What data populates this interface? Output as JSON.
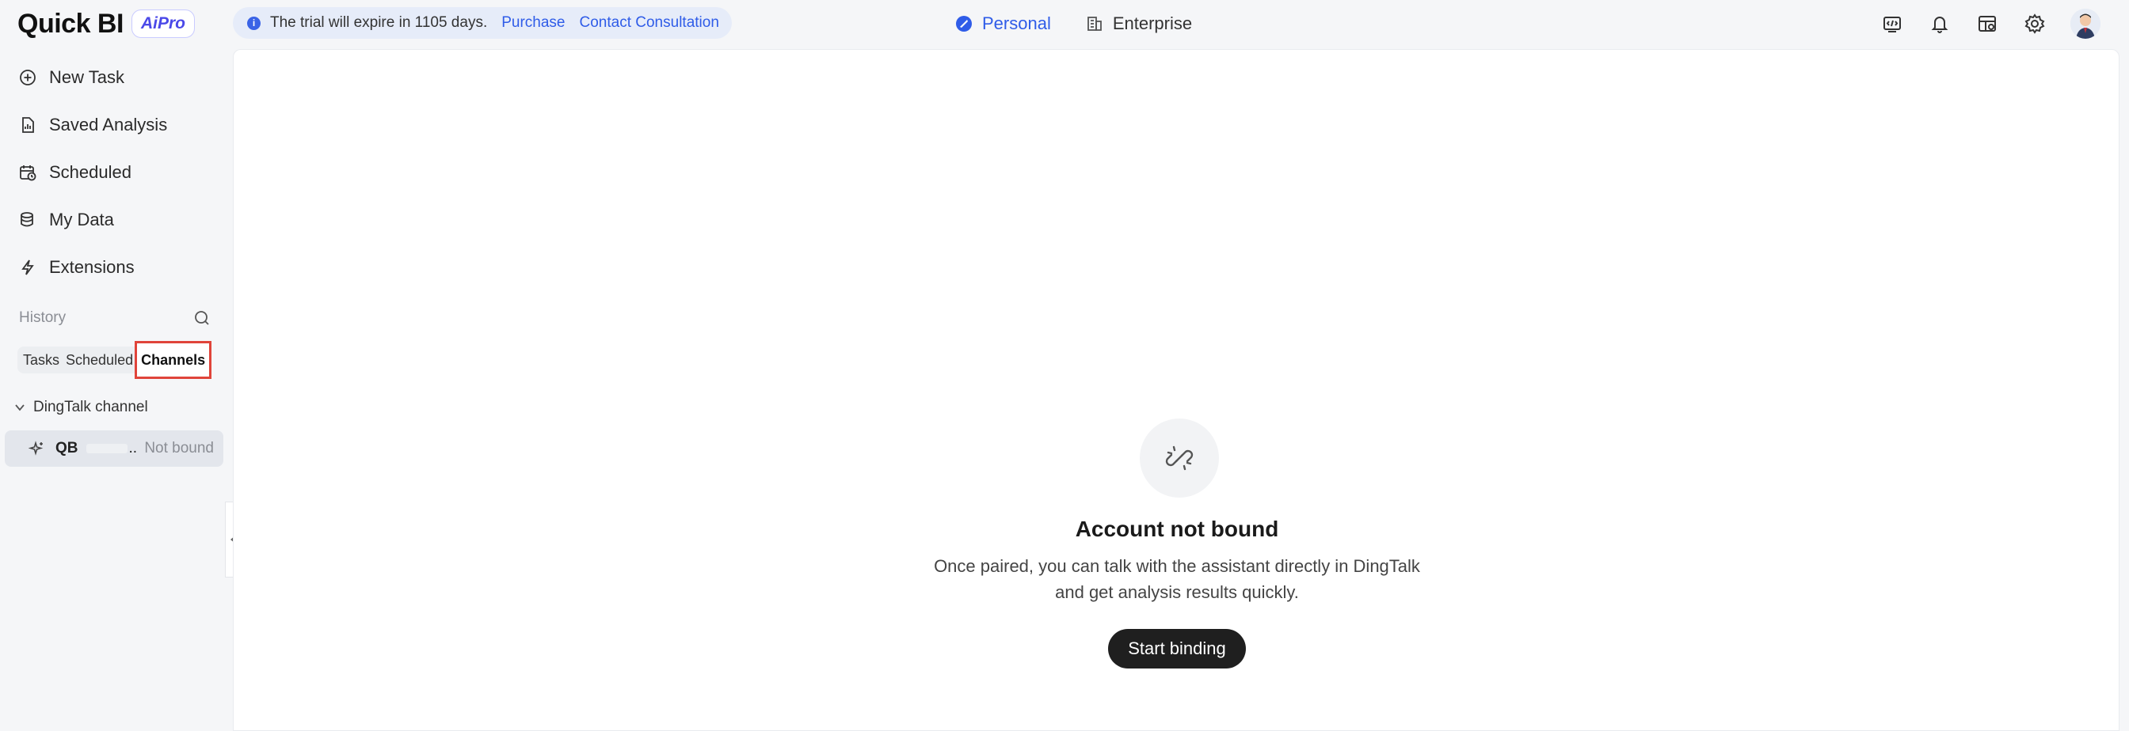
{
  "header": {
    "logo_text": "Quick BI",
    "logo_badge": "AiPro",
    "trial_text": "The trial will expire in 1105 days.",
    "purchase_link": "Purchase",
    "contact_link": "Contact Consultation",
    "modes": [
      {
        "label": "Personal",
        "active": true
      },
      {
        "label": "Enterprise",
        "active": false
      }
    ],
    "icons": [
      "api-icon",
      "bell-icon",
      "dashboard-icon",
      "gear-icon"
    ]
  },
  "sidebar": {
    "nav": [
      {
        "label": "New Task",
        "icon": "plus-circle-icon"
      },
      {
        "label": "Saved Analysis",
        "icon": "document-icon"
      },
      {
        "label": "Scheduled",
        "icon": "calendar-clock-icon"
      },
      {
        "label": "My Data",
        "icon": "database-icon"
      },
      {
        "label": "Extensions",
        "icon": "lightning-icon"
      }
    ],
    "history_label": "History",
    "tabs": {
      "tasks": "Tasks",
      "scheduled": "Scheduled",
      "channels": "Channels"
    },
    "group_label": "DingTalk channel",
    "channel": {
      "name": "QB",
      "ellipsis": "..",
      "status": "Not bound"
    }
  },
  "main": {
    "empty_title": "Account not bound",
    "empty_desc_line1": "Once paired, you can talk with the assistant directly in DingTalk",
    "empty_desc_line2": "and get analysis results quickly.",
    "start_button": "Start binding"
  },
  "colors": {
    "accent": "#2f5ce8",
    "highlight_border": "#e0443a",
    "button_dark": "#1f1f1f"
  }
}
